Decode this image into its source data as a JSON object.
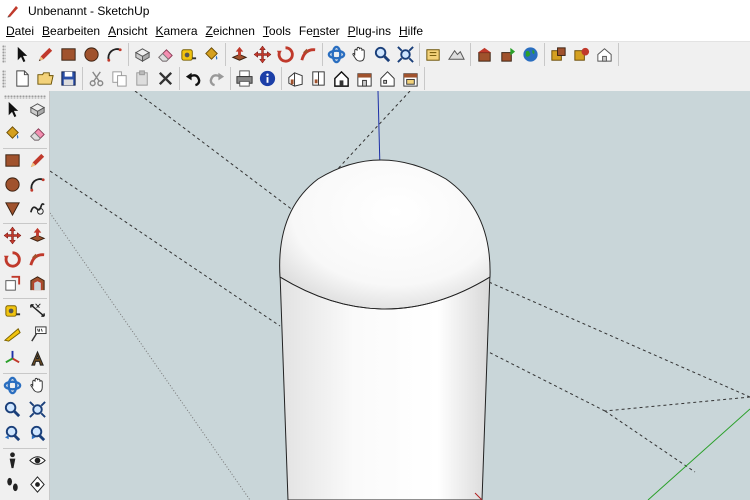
{
  "window": {
    "title": "Unbenannt - SketchUp"
  },
  "menu": [
    {
      "pre": "",
      "ul": "D",
      "post": "atei"
    },
    {
      "pre": "",
      "ul": "B",
      "post": "earbeiten"
    },
    {
      "pre": "",
      "ul": "A",
      "post": "nsicht"
    },
    {
      "pre": "",
      "ul": "K",
      "post": "amera"
    },
    {
      "pre": "",
      "ul": "Z",
      "post": "eichnen"
    },
    {
      "pre": "",
      "ul": "T",
      "post": "ools"
    },
    {
      "pre": "Fe",
      "ul": "n",
      "post": "ster"
    },
    {
      "pre": "",
      "ul": "P",
      "post": "lug-ins"
    },
    {
      "pre": "",
      "ul": "H",
      "post": "ilfe"
    }
  ],
  "colors": {
    "viewport_bg": "#c9d6d9",
    "blue_axis": "#1c2fa8",
    "green_axis": "#2aa02a",
    "red_axis": "#b02020",
    "edge": "#222222"
  }
}
